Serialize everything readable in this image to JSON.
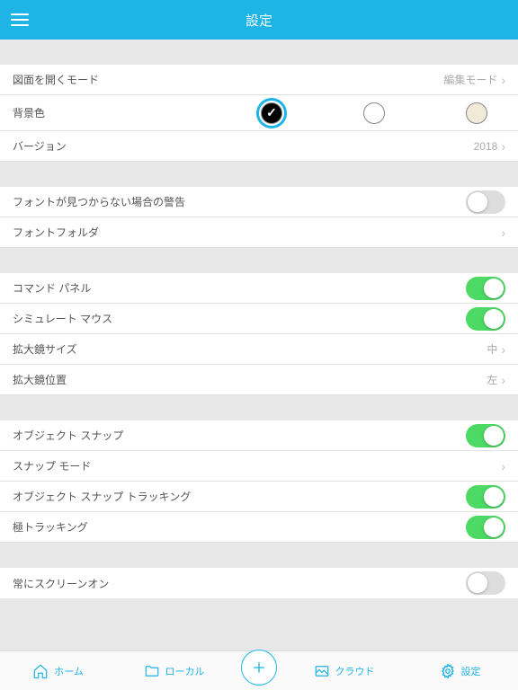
{
  "header": {
    "title": "設定"
  },
  "groups": [
    {
      "rows": [
        {
          "key": "open-mode",
          "label": "図面を開くモード",
          "type": "link",
          "value": "編集モード"
        },
        {
          "key": "bg-color",
          "label": "背景色",
          "type": "color",
          "selected": 0,
          "colors": [
            "#000000",
            "#ffffff",
            "#f0ead6"
          ]
        },
        {
          "key": "version",
          "label": "バージョン",
          "type": "link",
          "value": "2018"
        }
      ]
    },
    {
      "rows": [
        {
          "key": "font-warning",
          "label": "フォントが見つからない場合の警告",
          "type": "toggle",
          "on": false
        },
        {
          "key": "font-folder",
          "label": "フォントフォルダ",
          "type": "link",
          "value": ""
        }
      ]
    },
    {
      "rows": [
        {
          "key": "command-panel",
          "label": "コマンド パネル",
          "type": "toggle",
          "on": true
        },
        {
          "key": "simulate-mouse",
          "label": "シミュレート マウス",
          "type": "toggle",
          "on": true
        },
        {
          "key": "magnifier-size",
          "label": "拡大鏡サイズ",
          "type": "link",
          "value": "中"
        },
        {
          "key": "magnifier-pos",
          "label": "拡大鏡位置",
          "type": "link",
          "value": "左"
        }
      ]
    },
    {
      "rows": [
        {
          "key": "object-snap",
          "label": "オブジェクト スナップ",
          "type": "toggle",
          "on": true
        },
        {
          "key": "snap-mode",
          "label": "スナップ モード",
          "type": "link",
          "value": ""
        },
        {
          "key": "object-snap-tracking",
          "label": "オブジェクト スナップ トラッキング",
          "type": "toggle",
          "on": true
        },
        {
          "key": "polar-tracking",
          "label": "極トラッキング",
          "type": "toggle",
          "on": true
        }
      ]
    },
    {
      "rows": [
        {
          "key": "screen-on",
          "label": "常にスクリーンオン",
          "type": "toggle",
          "on": false
        }
      ]
    }
  ],
  "tabs": [
    {
      "key": "home",
      "label": "ホーム"
    },
    {
      "key": "local",
      "label": "ローカル"
    },
    {
      "key": "cloud",
      "label": "クラウド"
    },
    {
      "key": "settings",
      "label": "設定"
    }
  ]
}
